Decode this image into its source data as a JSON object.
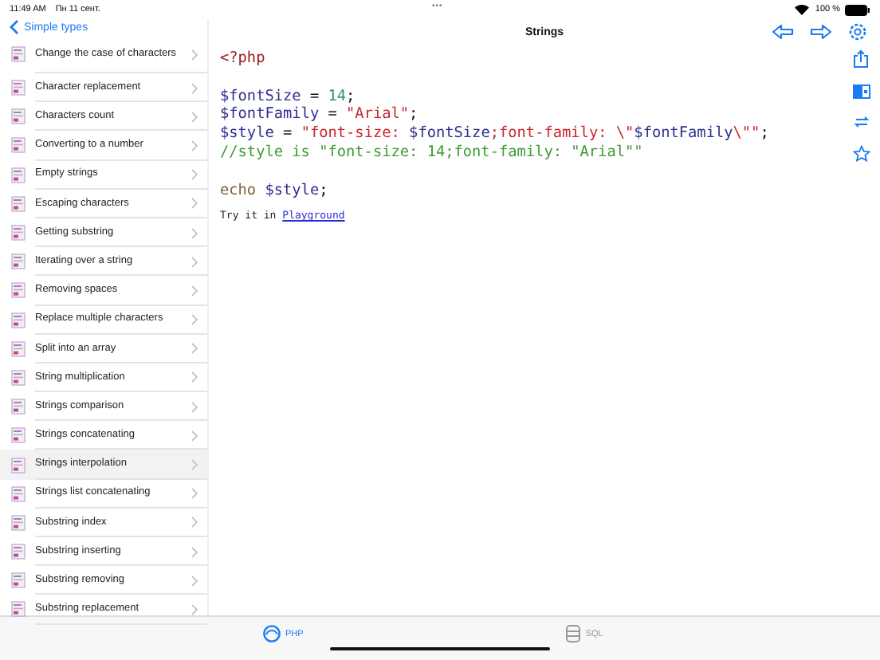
{
  "status_bar": {
    "time": "11:49 AM",
    "date": "Пн 11 сент.",
    "multitask": "•••",
    "battery": "100 %"
  },
  "nav": {
    "back": "Simple types",
    "title": "Strings"
  },
  "sidebar": {
    "items": [
      {
        "label": "Change the case of characters",
        "selected": false
      },
      {
        "label": "Character replacement",
        "selected": false
      },
      {
        "label": "Characters count",
        "selected": false
      },
      {
        "label": "Converting to a number",
        "selected": false
      },
      {
        "label": "Empty strings",
        "selected": false
      },
      {
        "label": "Escaping characters",
        "selected": false
      },
      {
        "label": "Getting substring",
        "selected": false
      },
      {
        "label": "Iterating over a string",
        "selected": false
      },
      {
        "label": "Removing spaces",
        "selected": false
      },
      {
        "label": "Replace multiple characters",
        "selected": false
      },
      {
        "label": "Split into an array",
        "selected": false
      },
      {
        "label": "String multiplication",
        "selected": false
      },
      {
        "label": "Strings comparison",
        "selected": false
      },
      {
        "label": "Strings concatenating",
        "selected": false
      },
      {
        "label": "Strings interpolation",
        "selected": true
      },
      {
        "label": "Strings list concatenating",
        "selected": false
      },
      {
        "label": "Substring index",
        "selected": false
      },
      {
        "label": "Substring inserting",
        "selected": false
      },
      {
        "label": "Substring removing",
        "selected": false
      },
      {
        "label": "Substring replacement",
        "selected": false
      }
    ]
  },
  "code": [
    {
      "blank_before": false,
      "tokens": [
        {
          "kind": "tag",
          "text": "<?php"
        }
      ]
    },
    {
      "blank_before": true,
      "tokens": [
        {
          "kind": "var",
          "text": "$fontSize"
        },
        {
          "kind": "plain",
          "text": " = "
        },
        {
          "kind": "number",
          "text": "14"
        },
        {
          "kind": "plain",
          "text": ";"
        }
      ]
    },
    {
      "blank_before": false,
      "tokens": [
        {
          "kind": "var",
          "text": "$fontFamily"
        },
        {
          "kind": "plain",
          "text": " = "
        },
        {
          "kind": "string",
          "text": "\"Arial\""
        },
        {
          "kind": "plain",
          "text": ";"
        }
      ]
    },
    {
      "blank_before": false,
      "tokens": [
        {
          "kind": "var",
          "text": "$style"
        },
        {
          "kind": "plain",
          "text": " = "
        },
        {
          "kind": "string",
          "text": "\"font-size: "
        },
        {
          "kind": "var",
          "text": "$fontSize"
        },
        {
          "kind": "string",
          "text": ";font-family: \\\""
        },
        {
          "kind": "var",
          "text": "$fontFamily"
        },
        {
          "kind": "string",
          "text": "\\\"\""
        },
        {
          "kind": "plain",
          "text": ";"
        }
      ]
    },
    {
      "blank_before": false,
      "tokens": [
        {
          "kind": "comment",
          "text": "//style is \"font-size: 14;font-family: \"Arial\"\""
        }
      ]
    },
    {
      "blank_before": true,
      "tokens": [
        {
          "kind": "keyword",
          "text": "echo"
        },
        {
          "kind": "var",
          "text": "$style",
          "space_before": true
        },
        {
          "kind": "plain",
          "text": ";"
        }
      ]
    }
  ],
  "try_it": {
    "text": "Try it in",
    "link": "Playground"
  },
  "tabs": [
    {
      "label": "PHP",
      "selected": true
    },
    {
      "label": "SQL",
      "selected": false
    }
  ]
}
